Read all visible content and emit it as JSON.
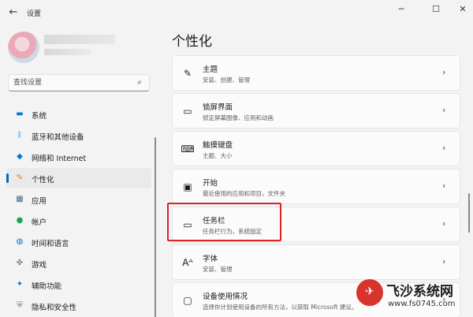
{
  "app": {
    "title": "设置",
    "back_icon": "arrow-left-icon"
  },
  "window": {
    "minimize": "─",
    "maximize": "☐",
    "close": "✕"
  },
  "user": {
    "avatar_icon": "avatar-icon"
  },
  "search": {
    "placeholder": "查找设置",
    "icon": "search-icon"
  },
  "sidebar": {
    "items": [
      {
        "label": "系统",
        "icon": "monitor-icon",
        "color": "#0078d4"
      },
      {
        "label": "蓝牙和其他设备",
        "icon": "bluetooth-icon",
        "color": "#0078d4"
      },
      {
        "label": "网络和 Internet",
        "icon": "wifi-icon",
        "color": "#0078d4"
      },
      {
        "label": "个性化",
        "icon": "brush-icon",
        "color": "#e07a1f",
        "active": true
      },
      {
        "label": "应用",
        "icon": "apps-icon",
        "color": "#4a6a8a"
      },
      {
        "label": "帐户",
        "icon": "person-icon",
        "color": "#1ea35a"
      },
      {
        "label": "时间和语言",
        "icon": "globe-clock-icon",
        "color": "#0078d4"
      },
      {
        "label": "游戏",
        "icon": "gamepad-icon",
        "color": "#6b6b6b"
      },
      {
        "label": "辅助功能",
        "icon": "accessibility-icon",
        "color": "#0078d4"
      },
      {
        "label": "隐私和安全性",
        "icon": "shield-icon",
        "color": "#6b6b6b"
      }
    ]
  },
  "main": {
    "title": "个性化",
    "cards": [
      {
        "title": "主题",
        "sub": "安装、创建、管理",
        "icon": "pen-icon"
      },
      {
        "title": "锁屏界面",
        "sub": "锁定屏幕图像、应用和动画",
        "icon": "lock-screen-icon"
      },
      {
        "title": "触摸键盘",
        "sub": "主题、大小",
        "icon": "keyboard-icon"
      },
      {
        "title": "开始",
        "sub": "最近使用的应用和项目，文件夹",
        "icon": "start-icon"
      },
      {
        "title": "任务栏",
        "sub": "任务栏行为，系统固定",
        "icon": "taskbar-icon"
      },
      {
        "title": "字体",
        "sub": "安装、管理",
        "icon": "font-icon"
      },
      {
        "title": "设备使用情况",
        "sub": "选择你计划使用设备的所有方法，以获取 Microsoft 建议。",
        "icon": "device-usage-icon"
      }
    ]
  },
  "watermark": {
    "text": "飞沙系统网",
    "url": "www.fs0745.com"
  }
}
